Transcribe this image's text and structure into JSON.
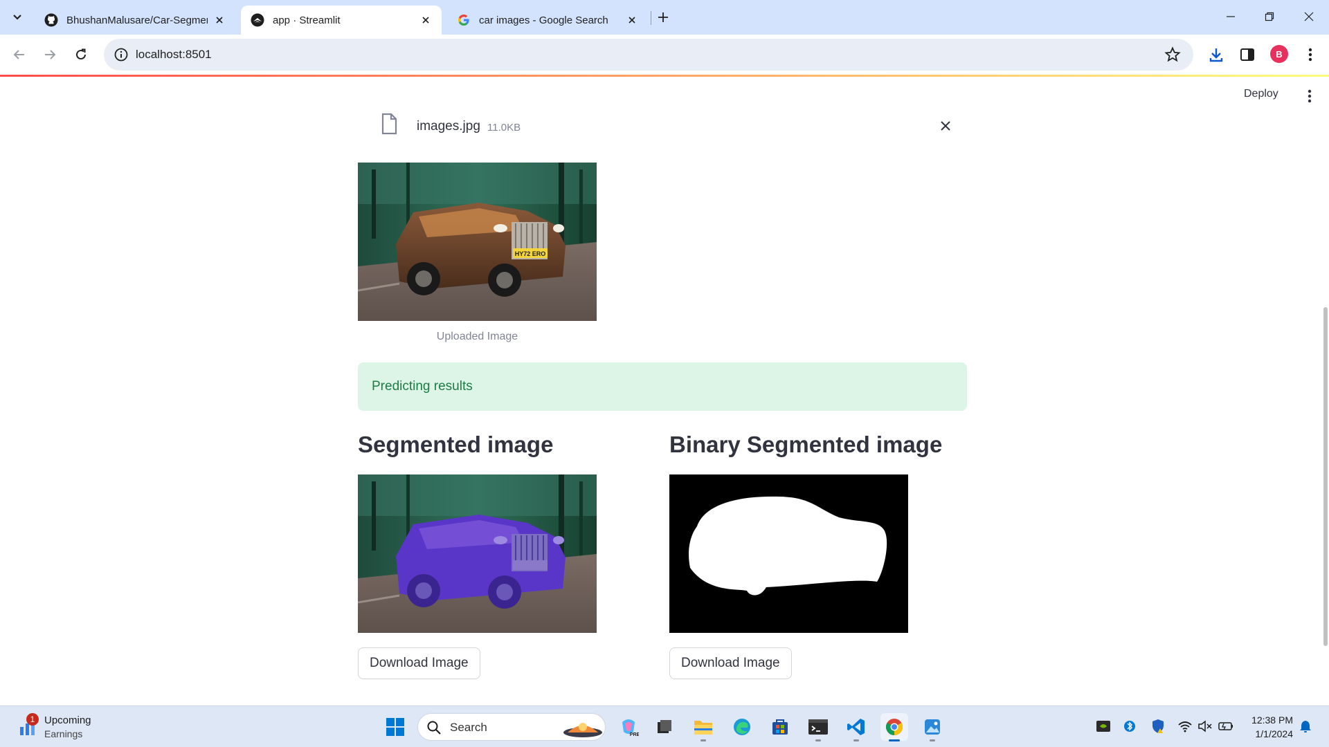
{
  "browser": {
    "tabs": [
      {
        "label": "BhushanMalusare/Car-Segmentation",
        "icon": "github-icon"
      },
      {
        "label": "app · Streamlit",
        "icon": "streamlit-icon",
        "active": true
      },
      {
        "label": "car images - Google Search",
        "icon": "google-icon"
      }
    ],
    "url": "localhost:8501",
    "profile_initial": "B"
  },
  "app": {
    "deploy_label": "Deploy",
    "file": {
      "name": "images.jpg",
      "size": "11.0KB"
    },
    "uploaded_caption": "Uploaded Image",
    "alert_text": "Predicting results",
    "segmented_title": "Segmented image",
    "binary_title": "Binary Segmented image",
    "download_label_1": "Download Image",
    "download_label_2": "Download Image",
    "plate_text": "HY72 ERO"
  },
  "taskbar": {
    "notification_count": "1",
    "widget_title": "Upcoming",
    "widget_subtitle": "Earnings",
    "search_placeholder": "Search",
    "time": "12:38 PM",
    "date": "1/1/2024"
  },
  "colors": {
    "tabstrip": "#d3e3fd",
    "success_bg": "#ddf5e6",
    "success_text": "#1c7c45",
    "segment_overlay": "#5a36c8"
  }
}
